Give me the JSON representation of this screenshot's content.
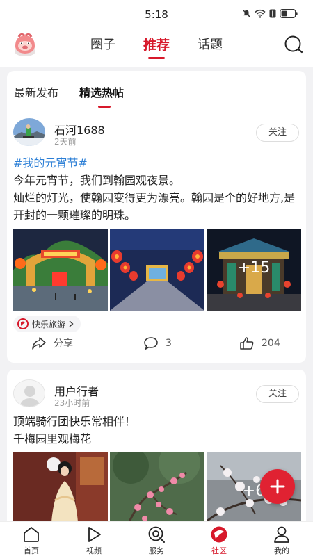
{
  "status_bar": {
    "time": "5:18"
  },
  "top_nav": {
    "tabs": [
      {
        "label": "圈子"
      },
      {
        "label": "推荐"
      },
      {
        "label": "话题"
      }
    ],
    "active": "推荐"
  },
  "sub_tabs": [
    {
      "label": "最新发布"
    },
    {
      "label": "精选热帖"
    }
  ],
  "posts": [
    {
      "user": "石河1688",
      "time": "2天前",
      "follow_label": "关注",
      "hashtag": "#我的元宵节#",
      "lines": [
        "今年元宵节，我们到翰园观夜景。",
        "灿烂的灯光，使翰园变得更为漂亮。翰园是个的好地方,是开封的一颗璀璨的明珠。"
      ],
      "more_images": "+15",
      "topic_label": "快乐旅游",
      "share_label": "分享",
      "comments": "3",
      "likes": "204"
    },
    {
      "user": "用户行者",
      "time": "23小时前",
      "follow_label": "关注",
      "lines": [
        "顶端骑行团快乐常相伴！",
        "千梅园里观梅花"
      ],
      "more_images": "+6"
    }
  ],
  "bottom_nav": [
    {
      "label": "首页",
      "icon": "home-icon"
    },
    {
      "label": "视频",
      "icon": "play-icon"
    },
    {
      "label": "服务",
      "icon": "service-icon"
    },
    {
      "label": "社区",
      "icon": "community-icon"
    },
    {
      "label": "我的",
      "icon": "profile-icon"
    }
  ],
  "colors": {
    "accent": "#d7192b",
    "hashtag": "#2c7fd6"
  }
}
